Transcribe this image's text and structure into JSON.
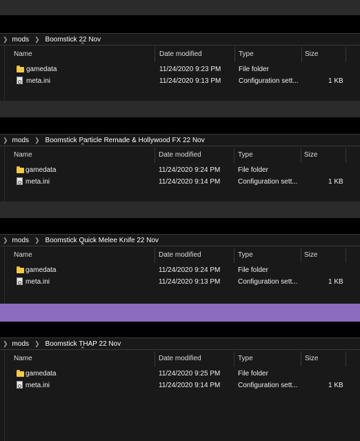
{
  "columns": {
    "name": "Name",
    "date": "Date modified",
    "type": "Type",
    "size": "Size"
  },
  "windows": [
    {
      "root": "mods",
      "folder": "Boomstick 22 Nov",
      "files": [
        {
          "name": "gamedata",
          "date": "11/24/2020 9:23 PM",
          "type": "File folder",
          "size": "",
          "icon": "folder-icon"
        },
        {
          "name": "meta.ini",
          "date": "11/24/2020 9:13 PM",
          "type": "Configuration sett...",
          "size": "1 KB",
          "icon": "config-file-icon"
        }
      ]
    },
    {
      "root": "mods",
      "folder": "Boomstick Particle Remade & Hollywood FX 22 Nov",
      "files": [
        {
          "name": "gamedata",
          "date": "11/24/2020 9:24 PM",
          "type": "File folder",
          "size": "",
          "icon": "folder-icon"
        },
        {
          "name": "meta.ini",
          "date": "11/24/2020 9:14 PM",
          "type": "Configuration sett...",
          "size": "1 KB",
          "icon": "config-file-icon"
        }
      ]
    },
    {
      "root": "mods",
      "folder": "Boomstick Quick Melee Knife 22 Nov",
      "files": [
        {
          "name": "gamedata",
          "date": "11/24/2020 9:24 PM",
          "type": "File folder",
          "size": "",
          "icon": "folder-icon"
        },
        {
          "name": "meta.ini",
          "date": "11/24/2020 9:13 PM",
          "type": "Configuration sett...",
          "size": "1 KB",
          "icon": "config-file-icon"
        }
      ]
    },
    {
      "root": "mods",
      "folder": "Boomstick THAP 22 Nov",
      "files": [
        {
          "name": "gamedata",
          "date": "11/24/2020 9:25 PM",
          "type": "File folder",
          "size": "",
          "icon": "folder-icon"
        },
        {
          "name": "meta.ini",
          "date": "11/24/2020 9:14 PM",
          "type": "Configuration sett...",
          "size": "1 KB",
          "icon": "config-file-icon"
        }
      ]
    }
  ],
  "colors": {
    "background": "#191919",
    "divider_purple": "#8b6cbf",
    "folder": "#f2c94c"
  }
}
